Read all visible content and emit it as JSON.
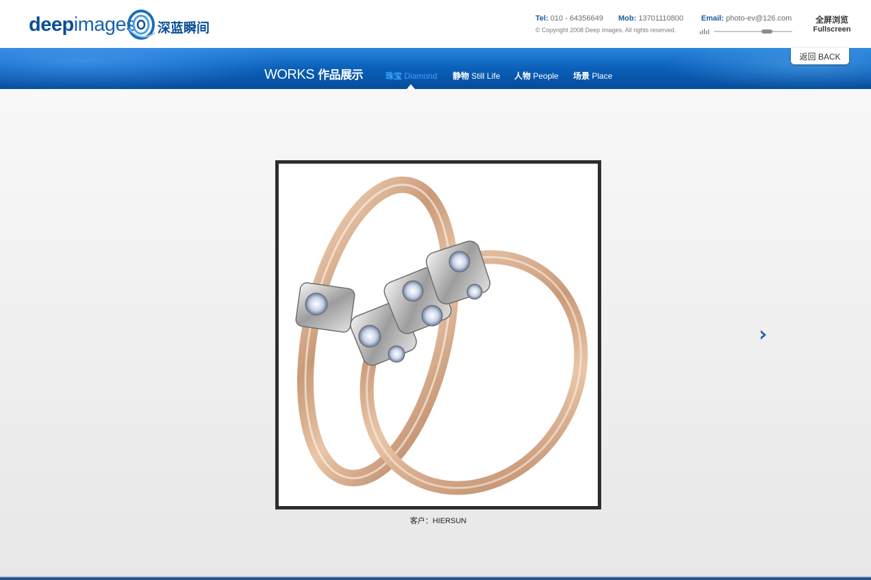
{
  "header": {
    "logo": {
      "brand_bold": "deep",
      "brand_light": "images",
      "brand_cn": "深蓝瞬间"
    },
    "tel_label": "Tel:",
    "tel_value": "010 - 64356649",
    "mob_label": "Mob:",
    "mob_value": "13701110800",
    "email_label": "Email:",
    "email_value": "photo-ev@126.com",
    "copyright": "© Copyright 2008 Deep Images. All rights reserved.",
    "volume_level": 0.7,
    "fullscreen_cn": "全屏浏览",
    "fullscreen_en": "Fullscreen"
  },
  "nav": {
    "works_en": "WORKS",
    "works_cn": "作品展示",
    "items": [
      {
        "cn": "珠宝",
        "en": "Diamond",
        "active": true
      },
      {
        "cn": "静物",
        "en": "Still Life",
        "active": false
      },
      {
        "cn": "人物",
        "en": "People",
        "active": false
      },
      {
        "cn": "场景",
        "en": "Place",
        "active": false
      }
    ],
    "back_cn": "返回",
    "back_en": "BACK"
  },
  "gallery": {
    "caption_label": "客户：",
    "caption_client": "HIERSUN",
    "next_icon": "chevron-right-icon"
  },
  "colors": {
    "brand_blue": "#0a4d96",
    "nav_active": "#36a6ff",
    "nav_band": "#0a5fb8"
  }
}
